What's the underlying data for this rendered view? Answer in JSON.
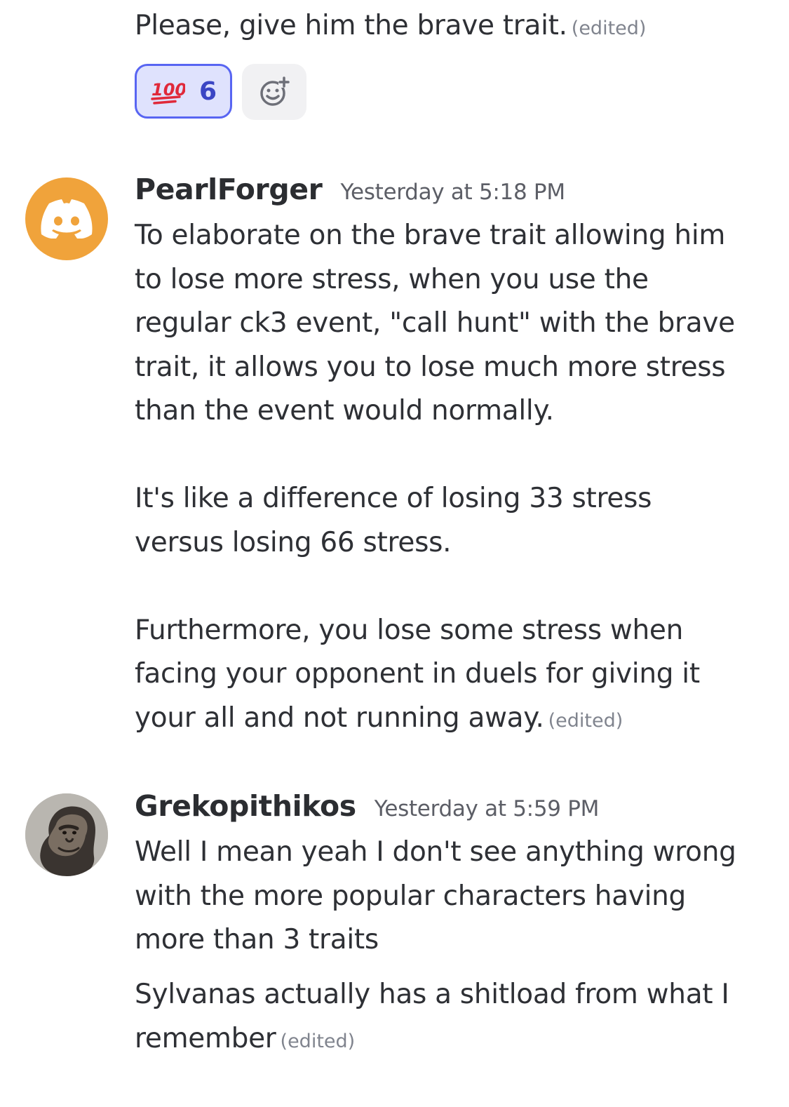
{
  "messages": {
    "prev_continuation": {
      "text": "Please, give him the brave trait.",
      "edited": "(edited)",
      "reaction": {
        "emoji": "hundred-points",
        "count": "6"
      }
    },
    "pearlforger": {
      "username": "PearlForger",
      "timestamp": "Yesterday at 5:18 PM",
      "avatar_icon": "discord-logo",
      "avatar_color": "#f0a33b",
      "paragraph1_lines": [
        "To elaborate on the brave trait allowing him",
        "to lose more stress, when you use the",
        "regular ck3 event, \"call hunt\" with the brave",
        "trait, it allows you to lose much more stress",
        "than the event would normally."
      ],
      "paragraph2_lines": [
        "It's like a difference of losing 33 stress",
        "versus losing 66 stress."
      ],
      "paragraph3_lines": [
        "Furthermore, you lose some stress when",
        "facing your opponent in duels for giving it",
        "your all and not running away."
      ],
      "edited": "(edited)"
    },
    "grekopithikos": {
      "username": "Grekopithikos",
      "timestamp": "Yesterday at 5:59 PM",
      "avatar_icon": "ape-portrait",
      "message1_lines": [
        "Well I mean yeah I don't see anything wrong",
        "with the more popular characters having",
        "more than 3 traits"
      ],
      "message2_lines": [
        "Sylvanas actually has a shitload from what I",
        "remember"
      ],
      "edited": "(edited)"
    }
  },
  "colors": {
    "accent": "#5865f2",
    "reaction_bg": "#dfe2fd",
    "text": "#2e3035",
    "muted": "#80848e"
  }
}
